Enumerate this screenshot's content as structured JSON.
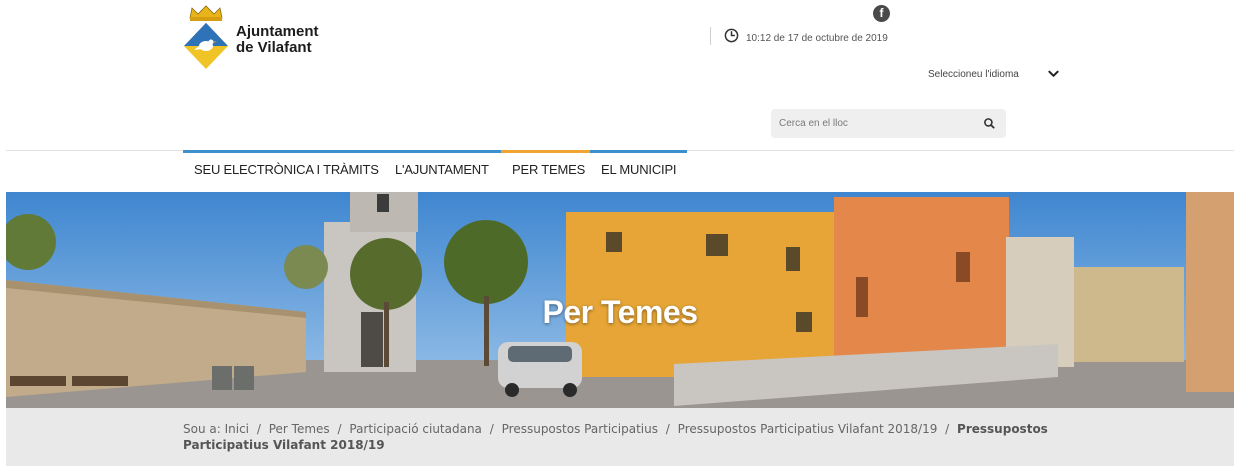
{
  "header": {
    "logo_line1": "Ajuntament",
    "logo_line2": "de Vilafant",
    "facebook_glyph": "f",
    "datetime": "10:12 de 17 de octubre de 2019",
    "language_label": "Seleccioneu l'idioma",
    "search_placeholder": "Cerca en el lloc"
  },
  "nav": {
    "items": [
      {
        "label": "SEU ELECTRÒNICA I TRÀMITS",
        "accent": "#3d8fce"
      },
      {
        "label": "L'AJUNTAMENT",
        "accent": "#3d8fce"
      },
      {
        "label": "PER TEMES",
        "accent": "#f0a433"
      },
      {
        "label": "EL MUNICIPI",
        "accent": "#3d8fce"
      }
    ]
  },
  "hero": {
    "title": "Per Temes"
  },
  "breadcrumb": {
    "prefix": "Sou a:",
    "items": [
      "Inici",
      "Per Temes",
      "Participació ciutadana",
      "Pressupostos Participatius",
      "Pressupostos Participatius Vilafant 2018/19"
    ],
    "current": "Pressupostos Participatius Vilafant 2018/19",
    "separator": "/"
  },
  "icons": {
    "facebook": "facebook-icon",
    "clock": "clock-icon",
    "chevron": "chevron-down-icon",
    "search": "search-icon"
  },
  "colors": {
    "accent_blue": "#3d8fce",
    "accent_orange": "#f0a433",
    "crumb_bg": "#e9e9e9"
  }
}
